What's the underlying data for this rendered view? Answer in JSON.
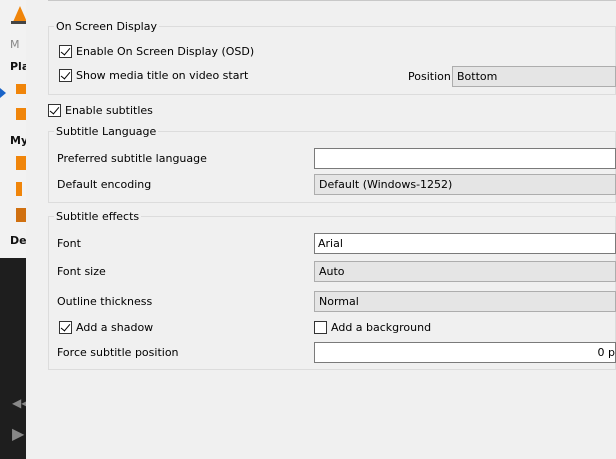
{
  "background_app": {
    "labels": [
      "M",
      "Pla",
      "My",
      "De"
    ]
  },
  "osd": {
    "group_title": "On Screen Display",
    "enable_osd_label": "Enable On Screen Display (OSD)",
    "enable_osd_checked": true,
    "show_title_label": "Show media title on video start",
    "show_title_checked": true,
    "position_label": "Position",
    "position_value": "Bottom"
  },
  "subtitles": {
    "enable_label": "Enable subtitles",
    "enable_checked": true
  },
  "subtitle_language": {
    "group_title": "Subtitle Language",
    "preferred_label": "Preferred subtitle language",
    "preferred_value": "",
    "encoding_label": "Default encoding",
    "encoding_value": "Default (Windows-1252)"
  },
  "subtitle_effects": {
    "group_title": "Subtitle effects",
    "font_label": "Font",
    "font_value": "Arial",
    "font_size_label": "Font size",
    "font_size_value": "Auto",
    "outline_label": "Outline thickness",
    "outline_value": "Normal",
    "shadow_label": "Add a shadow",
    "shadow_checked": true,
    "background_label": "Add a background",
    "background_checked": false,
    "force_position_label": "Force subtitle position",
    "force_position_value": "0 p"
  }
}
